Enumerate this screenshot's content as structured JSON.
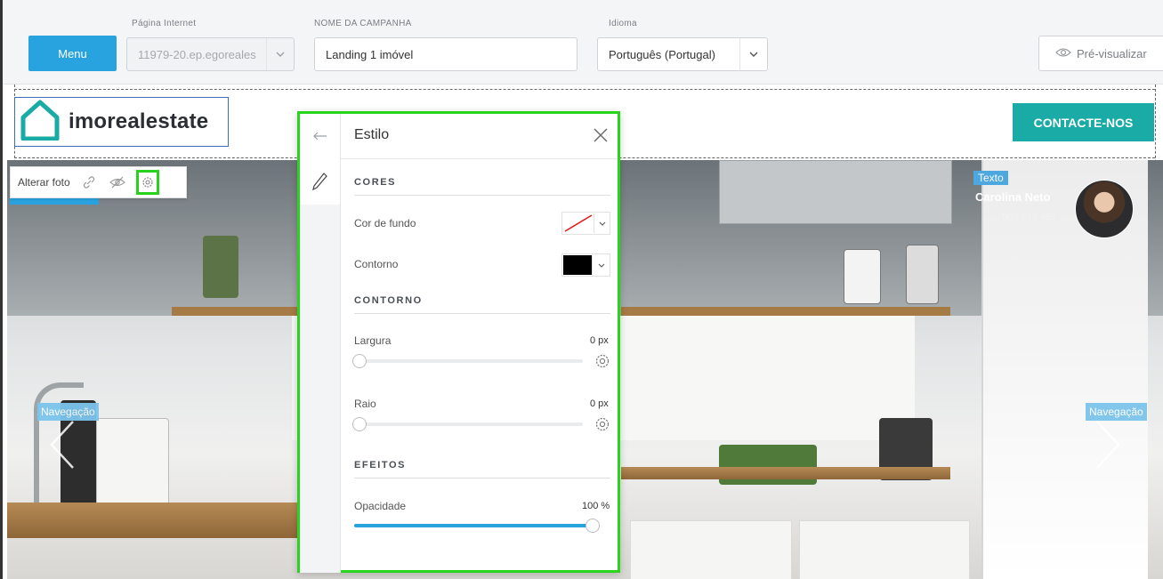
{
  "topbar": {
    "menu_label": "Menu",
    "site_label": "Página Internet",
    "site_value": "11979-20.ep.egoreales",
    "campaign_label": "NOME DA CAMPANHA",
    "campaign_value": "Landing 1 imóvel",
    "language_label": "Idioma",
    "language_value": "Português (Portugal)",
    "preview_label": "Pré-visualizar"
  },
  "page": {
    "logo_text": "imorealestate",
    "cta_label": "CONTACTE-NOS",
    "photo_toolbar": {
      "change_photo_label": "Alterar foto"
    },
    "nav_left_label": "Navegação",
    "nav_right_label": "Navegação",
    "agent": {
      "tag_label": "Texto",
      "name": "Carolina Neto",
      "phone": "900 526 483"
    }
  },
  "style_panel": {
    "title": "Estilo",
    "colors_section": "CORES",
    "bg_color_label": "Cor de fundo",
    "border_color_label": "Contorno",
    "border_color_value": "#000000",
    "border_section": "CONTORNO",
    "width_label": "Largura",
    "width_value": "0 px",
    "width_level": 0,
    "radius_label": "Raio",
    "radius_value": "0 px",
    "radius_level": 0,
    "effects_section": "EFEITOS",
    "opacity_label": "Opacidade",
    "opacity_value": "100 %",
    "opacity_level": 1.0
  },
  "colors": {
    "accent_blue": "#29a3e0",
    "cta_teal": "#1aaba7",
    "highlight_green": "#29d41c"
  }
}
